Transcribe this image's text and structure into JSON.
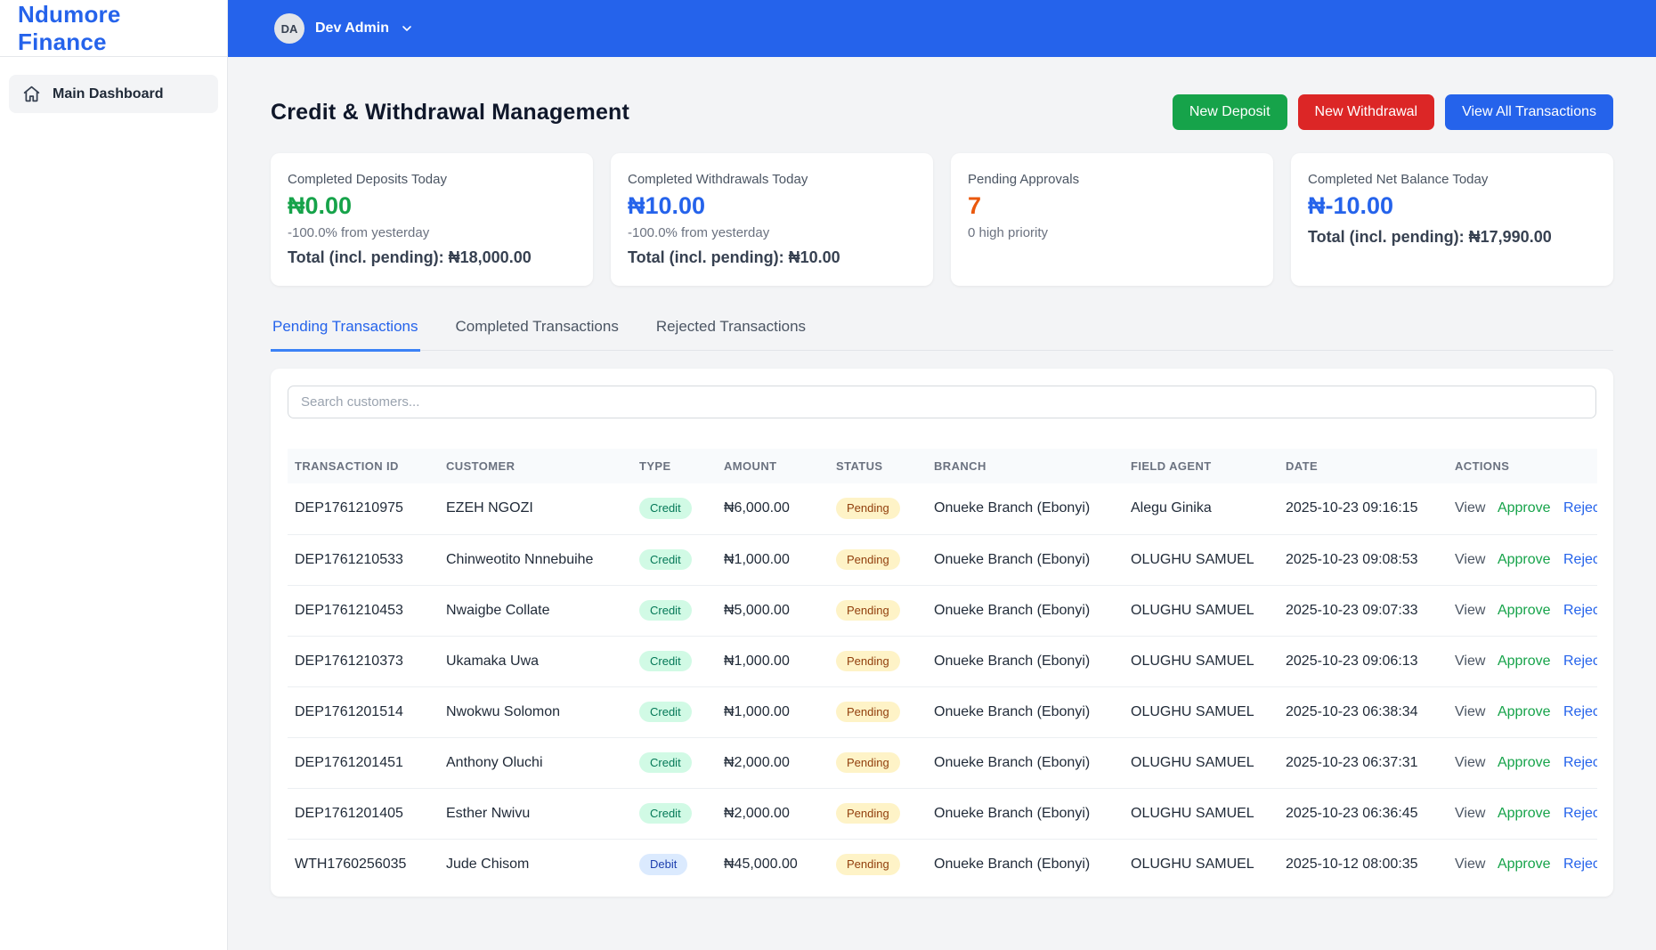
{
  "brand": {
    "name": "Ndumore Finance"
  },
  "topbar": {
    "avatar_initials": "DA",
    "user_name": "Dev Admin"
  },
  "sidebar": {
    "items": [
      {
        "label": "Main Dashboard"
      }
    ]
  },
  "page": {
    "title": "Credit & Withdrawal Management",
    "buttons": {
      "new_deposit": "New Deposit",
      "new_withdrawal": "New Withdrawal",
      "view_all": "View All Transactions"
    }
  },
  "theme": {
    "topbar_blue": "#2563eb",
    "brand_blue": "#2563eb",
    "success_green": "#16a34a",
    "danger_red": "#dc2626",
    "pending_orange": "#ea580c"
  },
  "stats": [
    {
      "label": "Completed Deposits Today",
      "value": "₦0.00",
      "value_color": "#16a34a",
      "sub": "-100.0% from yesterday",
      "total": "Total (incl. pending): ₦18,000.00"
    },
    {
      "label": "Completed Withdrawals Today",
      "value": "₦10.00",
      "value_color": "#2563eb",
      "sub": "-100.0% from yesterday",
      "total": "Total (incl. pending): ₦10.00"
    },
    {
      "label": "Pending Approvals",
      "value": "7",
      "value_color": "#ea580c",
      "sub": "0 high priority",
      "total": ""
    },
    {
      "label": "Completed Net Balance Today",
      "value": "₦-10.00",
      "value_color": "#2563eb",
      "sub": "",
      "total": "Total (incl. pending): ₦17,990.00"
    }
  ],
  "tabs": [
    {
      "label": "Pending Transactions",
      "active": true
    },
    {
      "label": "Completed Transactions",
      "active": false
    },
    {
      "label": "Rejected Transactions",
      "active": false
    }
  ],
  "search": {
    "placeholder": "Search customers..."
  },
  "table": {
    "columns": [
      "TRANSACTION ID",
      "CUSTOMER",
      "TYPE",
      "AMOUNT",
      "STATUS",
      "BRANCH",
      "FIELD AGENT",
      "DATE",
      "ACTIONS"
    ],
    "actions": {
      "view": "View",
      "approve": "Approve",
      "reject": "Reject"
    },
    "rows": [
      {
        "id": "DEP1761210975",
        "customer": "EZEH NGOZI",
        "type": "Credit",
        "amount": "₦6,000.00",
        "status": "Pending",
        "branch": "Onueke Branch (Ebonyi)",
        "agent": "Alegu Ginika",
        "date": "2025-10-23 09:16:15"
      },
      {
        "id": "DEP1761210533",
        "customer": "Chinweotito Nnnebuihe",
        "type": "Credit",
        "amount": "₦1,000.00",
        "status": "Pending",
        "branch": "Onueke Branch (Ebonyi)",
        "agent": "OLUGHU SAMUEL",
        "date": "2025-10-23 09:08:53"
      },
      {
        "id": "DEP1761210453",
        "customer": "Nwaigbe Collate",
        "type": "Credit",
        "amount": "₦5,000.00",
        "status": "Pending",
        "branch": "Onueke Branch (Ebonyi)",
        "agent": "OLUGHU SAMUEL",
        "date": "2025-10-23 09:07:33"
      },
      {
        "id": "DEP1761210373",
        "customer": "Ukamaka Uwa",
        "type": "Credit",
        "amount": "₦1,000.00",
        "status": "Pending",
        "branch": "Onueke Branch (Ebonyi)",
        "agent": "OLUGHU SAMUEL",
        "date": "2025-10-23 09:06:13"
      },
      {
        "id": "DEP1761201514",
        "customer": "Nwokwu Solomon",
        "type": "Credit",
        "amount": "₦1,000.00",
        "status": "Pending",
        "branch": "Onueke Branch (Ebonyi)",
        "agent": "OLUGHU SAMUEL",
        "date": "2025-10-23 06:38:34"
      },
      {
        "id": "DEP1761201451",
        "customer": "Anthony Oluchi",
        "type": "Credit",
        "amount": "₦2,000.00",
        "status": "Pending",
        "branch": "Onueke Branch (Ebonyi)",
        "agent": "OLUGHU SAMUEL",
        "date": "2025-10-23 06:37:31"
      },
      {
        "id": "DEP1761201405",
        "customer": "Esther Nwivu",
        "type": "Credit",
        "amount": "₦2,000.00",
        "status": "Pending",
        "branch": "Onueke Branch (Ebonyi)",
        "agent": "OLUGHU SAMUEL",
        "date": "2025-10-23 06:36:45"
      },
      {
        "id": "WTH1760256035",
        "customer": "Jude Chisom",
        "type": "Debit",
        "amount": "₦45,000.00",
        "status": "Pending",
        "branch": "Onueke Branch (Ebonyi)",
        "agent": "OLUGHU SAMUEL",
        "date": "2025-10-12 08:00:35"
      }
    ]
  }
}
